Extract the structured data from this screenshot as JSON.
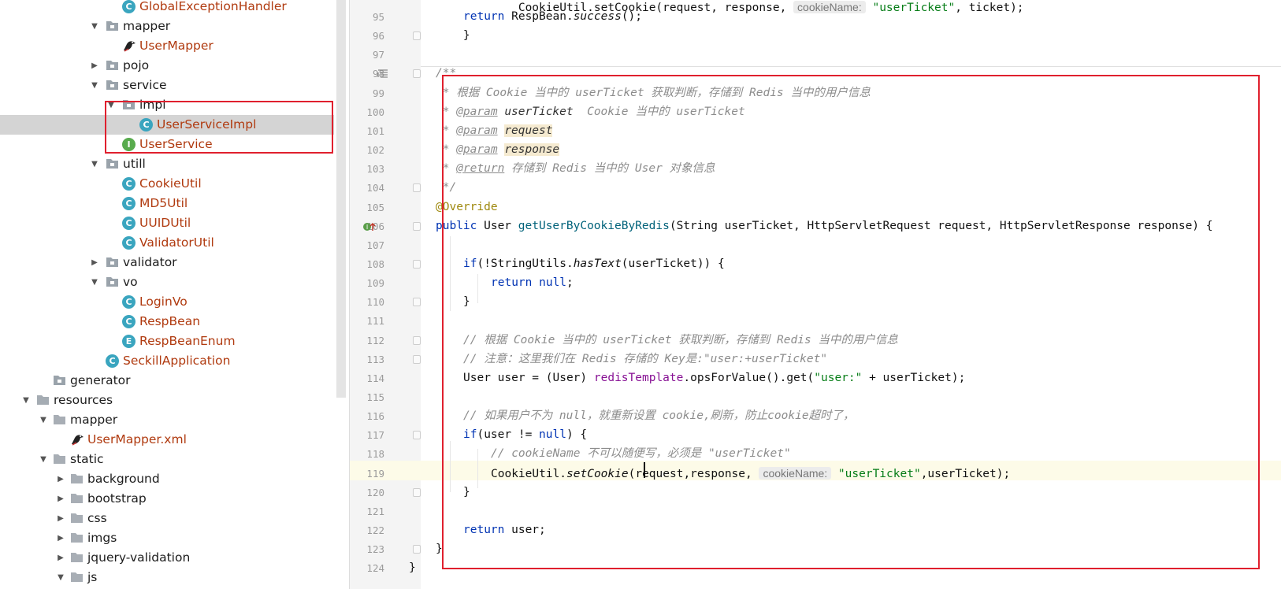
{
  "project_tree": {
    "rows": [
      {
        "label": "GlobalExceptionHandler",
        "kind": "java",
        "icon": "class-icon",
        "badge": "C"
      },
      {
        "label": "mapper",
        "kind": "dir",
        "icon": "package-folder-icon",
        "expanded": true
      },
      {
        "label": "UserMapper",
        "kind": "java",
        "icon": "mybatis-bird-icon"
      },
      {
        "label": "pojo",
        "kind": "dir",
        "icon": "package-folder-icon",
        "expanded": false
      },
      {
        "label": "service",
        "kind": "dir",
        "icon": "package-folder-icon",
        "expanded": true
      },
      {
        "label": "impl",
        "kind": "dir",
        "icon": "package-folder-icon",
        "expanded": true
      },
      {
        "label": "UserServiceImpl",
        "kind": "java",
        "icon": "class-icon",
        "badge": "C",
        "selected": true
      },
      {
        "label": "UserService",
        "kind": "java",
        "icon": "interface-icon",
        "badge": "I"
      },
      {
        "label": "utill",
        "kind": "dir",
        "icon": "package-folder-icon",
        "expanded": true
      },
      {
        "label": "CookieUtil",
        "kind": "java",
        "icon": "class-icon",
        "badge": "C"
      },
      {
        "label": "MD5Util",
        "kind": "java",
        "icon": "class-icon",
        "badge": "C"
      },
      {
        "label": "UUIDUtil",
        "kind": "java",
        "icon": "class-icon",
        "badge": "C"
      },
      {
        "label": "ValidatorUtil",
        "kind": "java",
        "icon": "class-icon",
        "badge": "C"
      },
      {
        "label": "validator",
        "kind": "dir",
        "icon": "package-folder-icon",
        "expanded": false
      },
      {
        "label": "vo",
        "kind": "dir",
        "icon": "package-folder-icon",
        "expanded": true
      },
      {
        "label": "LoginVo",
        "kind": "java",
        "icon": "class-icon",
        "badge": "C"
      },
      {
        "label": "RespBean",
        "kind": "java",
        "icon": "class-icon",
        "badge": "C"
      },
      {
        "label": "RespBeanEnum",
        "kind": "java",
        "icon": "enum-icon",
        "badge": "E"
      },
      {
        "label": "SeckillApplication",
        "kind": "java",
        "icon": "spring-boot-class-icon",
        "badge": "C"
      },
      {
        "label": "generator",
        "kind": "dir",
        "icon": "package-folder-icon"
      },
      {
        "label": "resources",
        "kind": "dir",
        "icon": "resources-folder-icon",
        "expanded": true
      },
      {
        "label": "mapper",
        "kind": "dir",
        "icon": "folder-icon",
        "expanded": true
      },
      {
        "label": "UserMapper.xml",
        "kind": "java",
        "icon": "mybatis-bird-icon"
      },
      {
        "label": "static",
        "kind": "dir",
        "icon": "folder-icon",
        "expanded": true
      },
      {
        "label": "background",
        "kind": "dir",
        "icon": "folder-icon",
        "expanded": false
      },
      {
        "label": "bootstrap",
        "kind": "dir",
        "icon": "folder-icon",
        "expanded": false
      },
      {
        "label": "css",
        "kind": "dir",
        "icon": "folder-icon",
        "expanded": false
      },
      {
        "label": "imgs",
        "kind": "dir",
        "icon": "folder-icon",
        "expanded": false
      },
      {
        "label": "jquery-validation",
        "kind": "dir",
        "icon": "folder-icon",
        "expanded": false
      },
      {
        "label": "js",
        "kind": "dir",
        "icon": "folder-icon",
        "expanded": true
      }
    ]
  },
  "editor": {
    "line_numbers": [
      "95",
      "96",
      "97",
      "98",
      "99",
      "100",
      "101",
      "102",
      "103",
      "104",
      "105",
      "106",
      "107",
      "108",
      "109",
      "110",
      "111",
      "112",
      "113",
      "114",
      "115",
      "116",
      "117",
      "118",
      "119",
      "120",
      "121",
      "122",
      "123",
      "124"
    ],
    "lines": {
      "l94": "        CookieUtil.setCookie(request, response, ",
      "l94_hint": "cookieName:",
      "l94_str": " \"userTicket\"",
      "l94_end": ", ticket);",
      "l95_kw": "return",
      "l95": " RespBean.",
      "l95_i": "success",
      "l95_end": "();",
      "l96": "    }",
      "l98": "/**",
      "l99": " * 根据 Cookie 当中的 userTicket 获取判断，存储到 Redis 当中的用户信息",
      "l100_pre": " * ",
      "l100_tag": "@param",
      "l100_p": " userTicket",
      "l100_rest": "  Cookie 当中的 userTicket",
      "l101_pre": " * ",
      "l101_tag": "@param",
      "l101_p": "request",
      "l102_pre": " * ",
      "l102_tag": "@param",
      "l102_p": "response",
      "l103_pre": " * ",
      "l103_tag": "@return",
      "l103_rest": " 存储到 Redis 当中的 User 对象信息",
      "l104": " */",
      "l105": "@Override",
      "l106_kw": "public",
      "l106_a": " User ",
      "l106_fn": "getUserByCookieByRedis",
      "l106_b": "(String userTicket, HttpServletRequest request, HttpServletResponse response) {",
      "l108_kw": "if",
      "l108_a": "(!StringUtils.",
      "l108_i": "hasText",
      "l108_b": "(userTicket)) {",
      "l109_kw": "return null",
      "l109_b": ";",
      "l110": "}",
      "l112": "// 根据 Cookie 当中的 userTicket 获取判断，存储到 Redis 当中的用户信息",
      "l113": "// 注意：这里我们在 Redis 存储的 Key是:\"user:+userTicket\"",
      "l114_a": "User user = (User) ",
      "l114_field": "redisTemplate",
      "l114_b": ".opsForValue().get(",
      "l114_str": "\"user:\"",
      "l114_c": " + userTicket);",
      "l116": "// 如果用户不为 null，就重新设置 cookie,刷新，防止cookie超时了，",
      "l117_kw": "if",
      "l117_a": "(user != ",
      "l117_kw2": "null",
      "l117_b": ") {",
      "l118": "// cookieName 不可以随便写，必须是 \"userTicket\"",
      "l119_a": "CookieUtil.",
      "l119_i": "setCookie",
      "l119_b": "(request,response, ",
      "l119_hint": "cookieName:",
      "l119_str": "\"userTicket\"",
      "l119_c": ",userTicket);",
      "l120": "}",
      "l122_kw": "return",
      "l122_b": " user;",
      "l123": "}",
      "l124": "}"
    }
  },
  "colors": {
    "highlight_box": "#e0202e",
    "keyword": "#0033b3",
    "comment": "#8c8c8c",
    "string": "#067d17",
    "annotation": "#9e880d",
    "method": "#00627a",
    "field": "#871094",
    "java_file": "#b03a0f"
  }
}
